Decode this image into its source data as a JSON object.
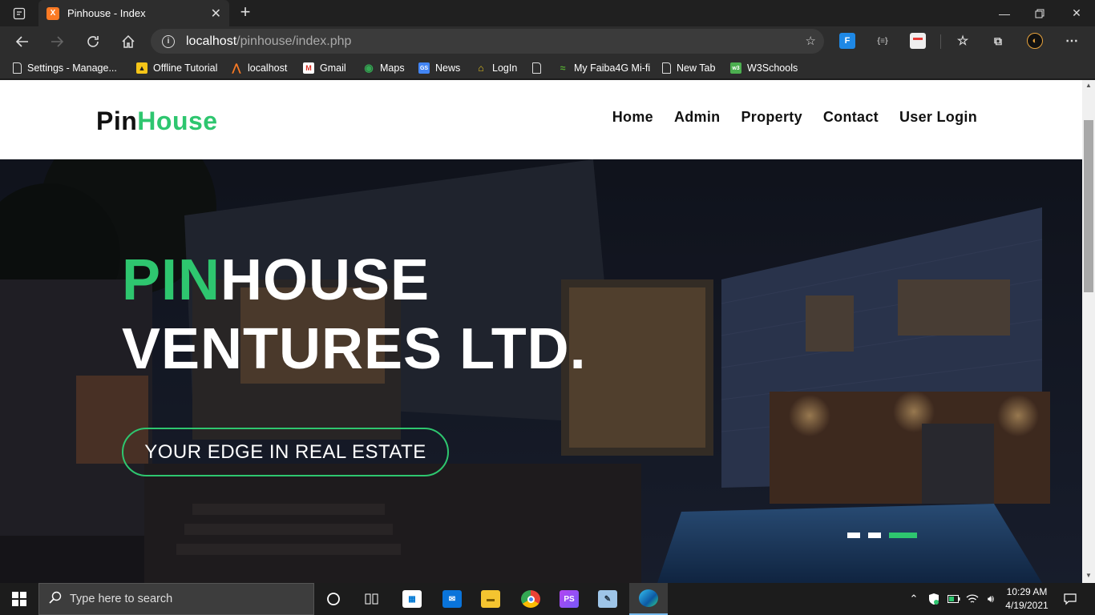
{
  "browser": {
    "tab_title": "Pinhouse - Index",
    "tab_favicon": "X",
    "url_host": "localhost",
    "url_path": "/pinhouse/index.php",
    "bookmarks": [
      {
        "label": "Settings - Manage...",
        "icon": "doc-icon",
        "color": "#dddddd"
      },
      {
        "label": "Offline Tutorial",
        "icon": "tutorial-icon",
        "color": "#f5c518"
      },
      {
        "label": "localhost",
        "icon": "xampp-icon",
        "color": "#fb7a24"
      },
      {
        "label": "Gmail",
        "icon": "gmail-icon",
        "color": "#d93025"
      },
      {
        "label": "Maps",
        "icon": "maps-icon",
        "color": "#34a853"
      },
      {
        "label": "News",
        "icon": "news-icon",
        "color": "#4285f4"
      },
      {
        "label": "LogIn",
        "icon": "login-icon",
        "color": "#e0c020"
      },
      {
        "label": "",
        "icon": "doc-icon",
        "color": "#dddddd"
      },
      {
        "label": "My Faiba4G Mi-fi",
        "icon": "faiba-icon",
        "color": "#55aa33"
      },
      {
        "label": "New Tab",
        "icon": "doc-icon",
        "color": "#dddddd"
      },
      {
        "label": "W3Schools",
        "icon": "w3schools-icon",
        "color": "#4caf50"
      }
    ]
  },
  "site": {
    "logo_part1": "Pin",
    "logo_part2": "House",
    "nav": [
      "Home",
      "Admin",
      "Property",
      "Contact",
      "User Login"
    ],
    "accent_color": "#2ec66f",
    "hero": {
      "title_accent": "PIN",
      "title_rest_line1": "HOUSE",
      "title_line2": "VENTURES LTD.",
      "cta_label": "YOUR EDGE IN REAL ESTATE",
      "slides_count": 3,
      "active_slide": 3
    }
  },
  "taskbar": {
    "search_placeholder": "Type here to search",
    "time": "10:29 AM",
    "date": "4/19/2021"
  }
}
